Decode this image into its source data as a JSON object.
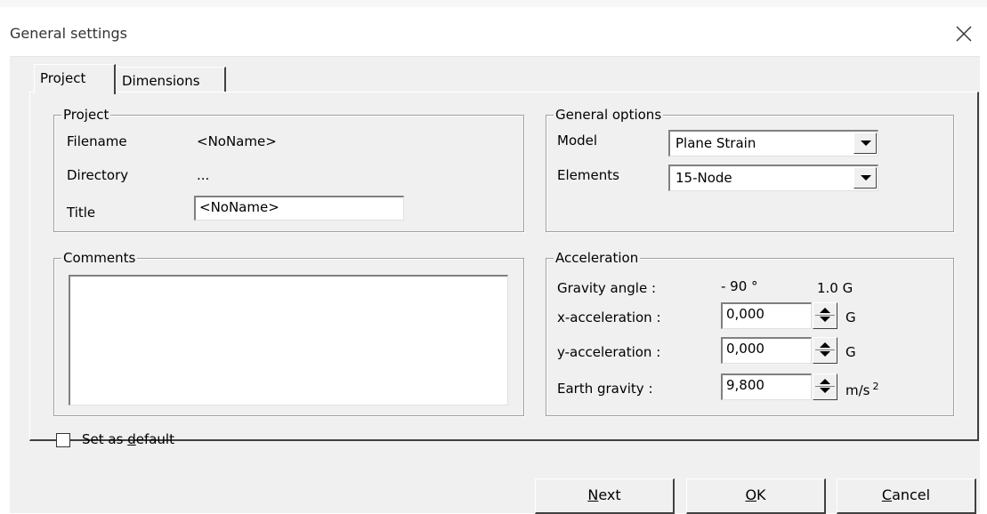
{
  "window": {
    "title": "General settings",
    "close_icon": "close-icon"
  },
  "tabs": [
    {
      "label": "Project",
      "active": true
    },
    {
      "label": "Dimensions",
      "active": false
    }
  ],
  "project_group": {
    "label": "Project",
    "filename_label": "Filename",
    "filename_value": "<NoName>",
    "directory_label": "Directory",
    "directory_value": "...",
    "title_label": "Title",
    "title_value": "<NoName>"
  },
  "comments_group": {
    "label": "Comments",
    "value": ""
  },
  "general_options": {
    "label": "General options",
    "model_label": "Model",
    "model_value": "Plane Strain",
    "elements_label": "Elements",
    "elements_value": "15-Node"
  },
  "acceleration": {
    "label": "Acceleration",
    "gravity_angle_label": "Gravity angle :",
    "gravity_angle_value": "- 90 °",
    "gravity_g_value": "1.0 G",
    "x_label": "x-acceleration :",
    "x_value": "0,000",
    "x_unit": "G",
    "y_label": "y-acceleration :",
    "y_value": "0,000",
    "y_unit": "G",
    "earth_label": "Earth gravity :",
    "earth_value": "9,800",
    "earth_unit": "m/s",
    "earth_unit_sup": "2"
  },
  "default_checkbox": {
    "label_pre": "Set as ",
    "label_u": "d",
    "label_post": "efault",
    "checked": false
  },
  "buttons": {
    "next_u": "N",
    "next_rest": "ext",
    "ok_u": "O",
    "ok_rest": "K",
    "cancel_u": "C",
    "cancel_rest": "ancel"
  }
}
